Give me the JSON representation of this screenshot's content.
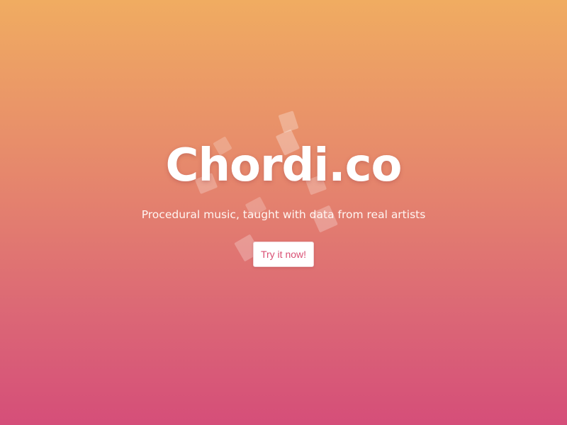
{
  "hero": {
    "logo_text": "Chordi.co",
    "tagline": "Procedural music, taught with data from real artists",
    "cta_label": "Try it now!"
  },
  "decoration": {
    "icon": "floating-music-shapes"
  },
  "colors": {
    "gradient_top": "#f0ac61",
    "gradient_bottom": "#d54e79",
    "text": "#ffffff",
    "button_text": "#d94f73",
    "button_background": "#ffffff"
  }
}
